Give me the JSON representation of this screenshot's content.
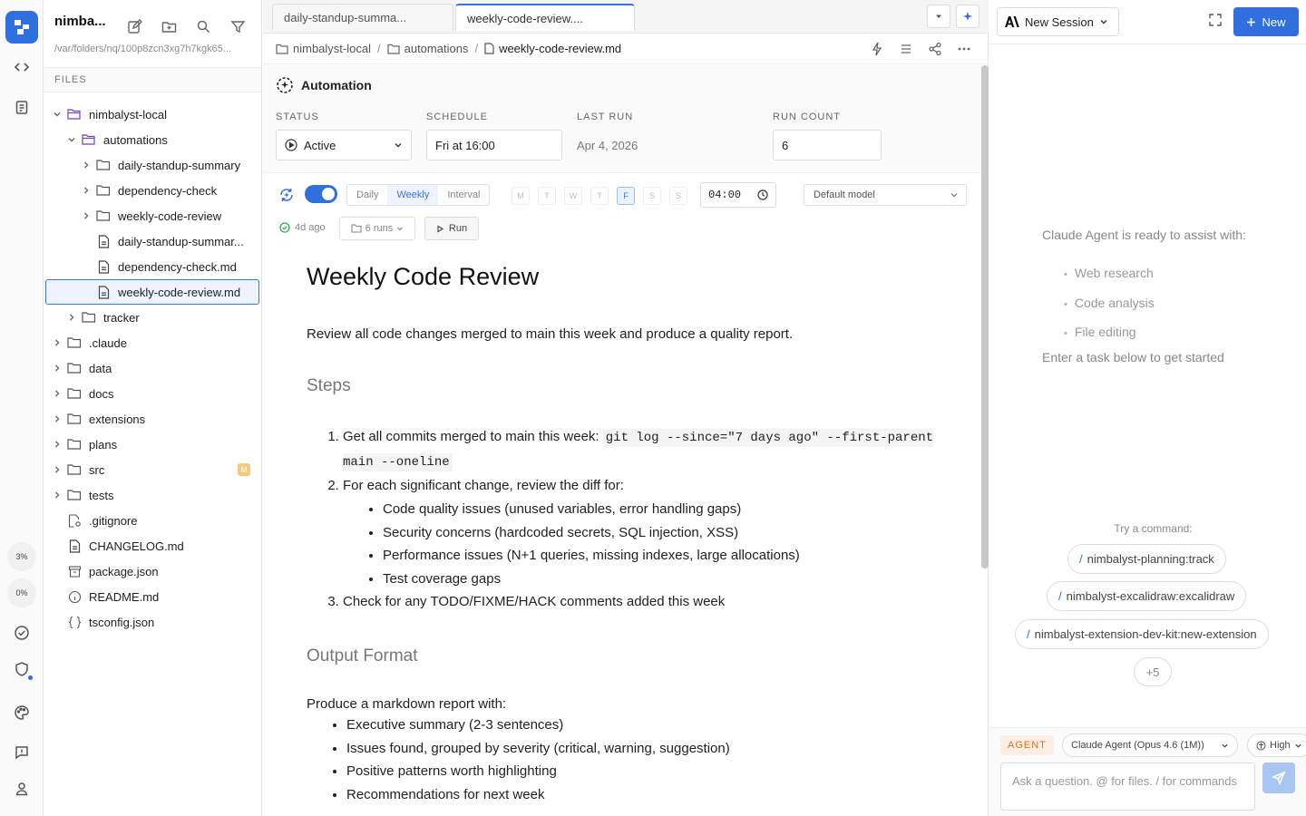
{
  "workspace": {
    "title": "nimba...",
    "path": "/var/folders/nq/100p8zcn3xg7h7kgk65..."
  },
  "rail": {
    "progress_1": "3%",
    "progress_2": "0%"
  },
  "files": {
    "header": "FILES",
    "tree": [
      {
        "name": "nimbalyst-local",
        "depth": 0,
        "kind": "folder-open",
        "chevron": "down"
      },
      {
        "name": "automations",
        "depth": 1,
        "kind": "folder-open",
        "chevron": "down"
      },
      {
        "name": "daily-standup-summary",
        "depth": 2,
        "kind": "folder",
        "chevron": "right"
      },
      {
        "name": "dependency-check",
        "depth": 2,
        "kind": "folder",
        "chevron": "right"
      },
      {
        "name": "weekly-code-review",
        "depth": 2,
        "kind": "folder",
        "chevron": "right"
      },
      {
        "name": "daily-standup-summar...",
        "depth": 2,
        "kind": "doc",
        "chevron": ""
      },
      {
        "name": "dependency-check.md",
        "depth": 2,
        "kind": "doc",
        "chevron": ""
      },
      {
        "name": "weekly-code-review.md",
        "depth": 2,
        "kind": "doc",
        "chevron": "",
        "selected": true
      },
      {
        "name": "tracker",
        "depth": 1,
        "kind": "folder",
        "chevron": "right"
      },
      {
        "name": ".claude",
        "depth": 0,
        "kind": "folder",
        "chevron": "right"
      },
      {
        "name": "data",
        "depth": 0,
        "kind": "folder",
        "chevron": "right"
      },
      {
        "name": "docs",
        "depth": 0,
        "kind": "folder",
        "chevron": "right"
      },
      {
        "name": "extensions",
        "depth": 0,
        "kind": "folder",
        "chevron": "right"
      },
      {
        "name": "plans",
        "depth": 0,
        "kind": "folder",
        "chevron": "right"
      },
      {
        "name": "src",
        "depth": 0,
        "kind": "folder",
        "chevron": "right",
        "badge": "M"
      },
      {
        "name": "tests",
        "depth": 0,
        "kind": "folder",
        "chevron": "right"
      },
      {
        "name": ".gitignore",
        "depth": 0,
        "kind": "gear-file",
        "chevron": ""
      },
      {
        "name": "CHANGELOG.md",
        "depth": 0,
        "kind": "doc",
        "chevron": ""
      },
      {
        "name": "package.json",
        "depth": 0,
        "kind": "package",
        "chevron": ""
      },
      {
        "name": "README.md",
        "depth": 0,
        "kind": "info",
        "chevron": ""
      },
      {
        "name": "tsconfig.json",
        "depth": 0,
        "kind": "braces",
        "chevron": ""
      }
    ]
  },
  "tabs": [
    {
      "label": "daily-standup-summa..."
    },
    {
      "label": "weekly-code-review...."
    }
  ],
  "breadcrumb": {
    "root": "nimbalyst-local",
    "folder": "automations",
    "file": "weekly-code-review.md"
  },
  "automation": {
    "title": "Automation",
    "status_label": "STATUS",
    "status_value": "Active",
    "schedule_label": "SCHEDULE",
    "schedule_value": "Fri at 16:00",
    "last_run_label": "LAST RUN",
    "last_run_value": "Apr 4, 2026",
    "run_count_label": "RUN COUNT",
    "run_count_value": "6",
    "enabled": true,
    "frequency_options": [
      "Daily",
      "Weekly",
      "Interval"
    ],
    "frequency_selected": "Weekly",
    "days": [
      "M",
      "T",
      "W",
      "T",
      "F",
      "S",
      "S"
    ],
    "day_selected_index": 4,
    "time": "04:00",
    "model": "Default model",
    "last_run_ago": "4d ago",
    "runs_label": "6 runs",
    "run_button": "Run"
  },
  "document": {
    "title": "Weekly Code Review",
    "intro": "Review all code changes merged to main this week and produce a quality report.",
    "steps_heading": "Steps",
    "step1_text": "Get all commits merged to main this week: ",
    "step1_code": "git log --since=\"7 days ago\" --first-parent main --oneline",
    "step2_text": "For each significant change, review the diff for:",
    "step2_items": [
      "Code quality issues (unused variables, error handling gaps)",
      "Security concerns (hardcoded secrets, SQL injection, XSS)",
      "Performance issues (N+1 queries, missing indexes, large allocations)",
      "Test coverage gaps"
    ],
    "step3_text": "Check for any TODO/FIXME/HACK comments added this week",
    "output_heading": "Output Format",
    "output_intro": "Produce a markdown report with:",
    "output_items": [
      "Executive summary (2-3 sentences)",
      "Issues found, grouped by severity (critical, warning, suggestion)",
      "Positive patterns worth highlighting",
      "Recommendations for next week"
    ]
  },
  "agent_panel": {
    "session_label": "New Session",
    "new_label": "New",
    "ready_text": "Claude Agent is ready to assist with:",
    "capabilities": [
      "Web research",
      "Code analysis",
      "File editing"
    ],
    "enter_text": "Enter a task below to get started",
    "try_label": "Try a command:",
    "commands": [
      "nimbalyst-planning:track",
      "nimbalyst-excalidraw:excalidraw",
      "nimbalyst-extension-dev-kit:new-extension"
    ],
    "more_label": "+5",
    "mode_badge": "AGENT",
    "model_label": "Claude Agent (Opus 4.6 (1M))",
    "effort_label": "High",
    "input_placeholder": "Ask a question. @ for files. / for commands"
  },
  "colors": {
    "accent": "#2f6fde",
    "badge_modified": "#f6c97a",
    "agent_badge": "#d4752a"
  }
}
